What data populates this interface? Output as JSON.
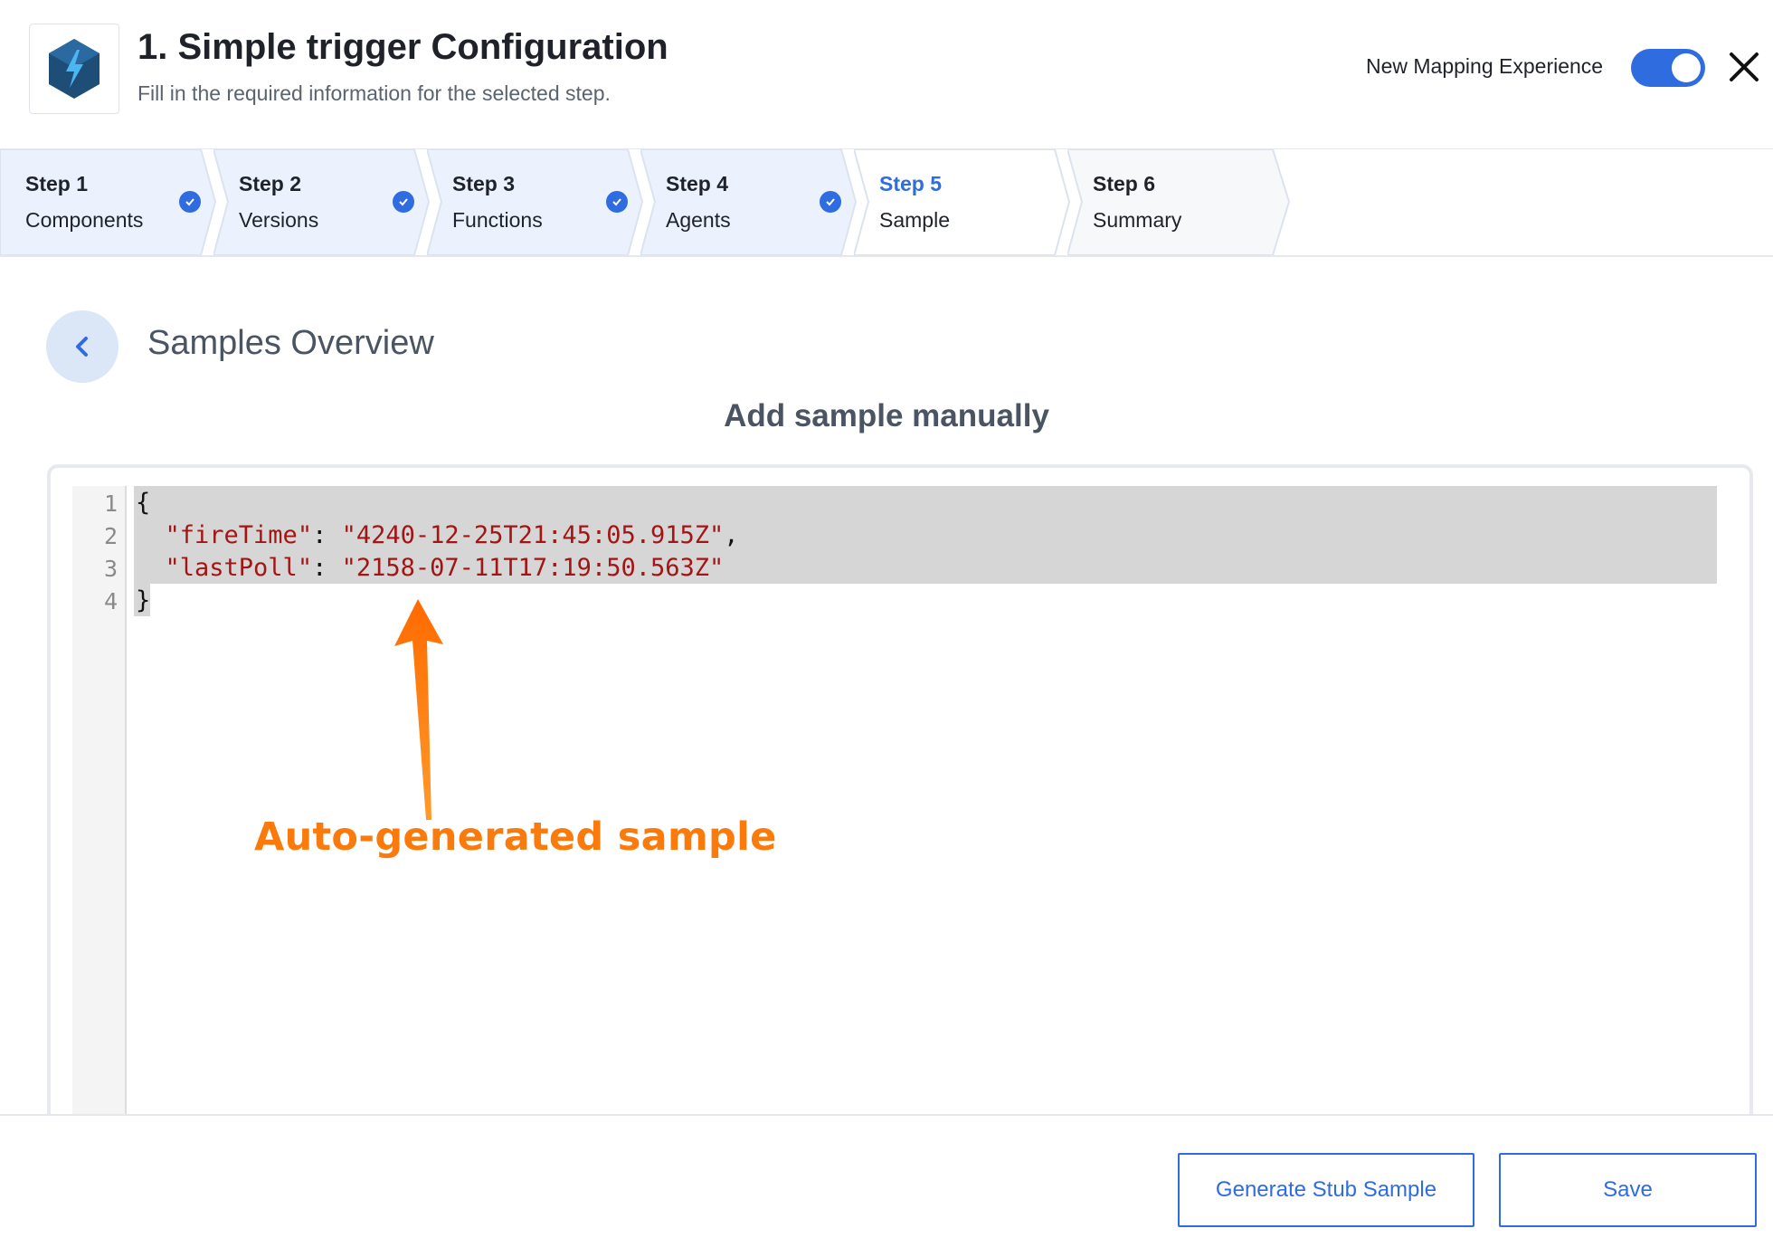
{
  "header": {
    "title": "1. Simple trigger Configuration",
    "subtitle": "Fill in the required information for the selected step.",
    "toggle_label": "New Mapping Experience",
    "toggle_on": true,
    "logo_icon": "lightning-hexagon-icon",
    "close_icon": "close-icon"
  },
  "steps": [
    {
      "title": "Step 1",
      "label": "Components",
      "state": "completed"
    },
    {
      "title": "Step 2",
      "label": "Versions",
      "state": "completed"
    },
    {
      "title": "Step 3",
      "label": "Functions",
      "state": "completed"
    },
    {
      "title": "Step 4",
      "label": "Agents",
      "state": "completed"
    },
    {
      "title": "Step 5",
      "label": "Sample",
      "state": "active"
    },
    {
      "title": "Step 6",
      "label": "Summary",
      "state": "pending"
    }
  ],
  "main": {
    "section_title": "Samples Overview",
    "sample_heading": "Add sample manually",
    "editor": {
      "line_numbers": [
        "1",
        "2",
        "3",
        "4"
      ],
      "lines": [
        {
          "key": "",
          "value": "",
          "raw": "{"
        },
        {
          "key": "\"fireTime\"",
          "value": "\"4240-12-25T21:45:05.915Z\"",
          "suffix": ","
        },
        {
          "key": "\"lastPoll\"",
          "value": "\"2158-07-11T17:19:50.563Z\"",
          "suffix": ""
        },
        {
          "key": "",
          "value": "",
          "raw": "}"
        }
      ]
    },
    "annotation": "Auto-generated sample"
  },
  "footer": {
    "generate_label": "Generate Stub Sample",
    "save_label": "Save"
  },
  "colors": {
    "accent": "#2f6ce0",
    "completed_step_bg": "#ecf2fd",
    "pending_step_bg": "#f7f8fa",
    "annotation": "#fb7a0c",
    "json_string": "#a31515"
  }
}
